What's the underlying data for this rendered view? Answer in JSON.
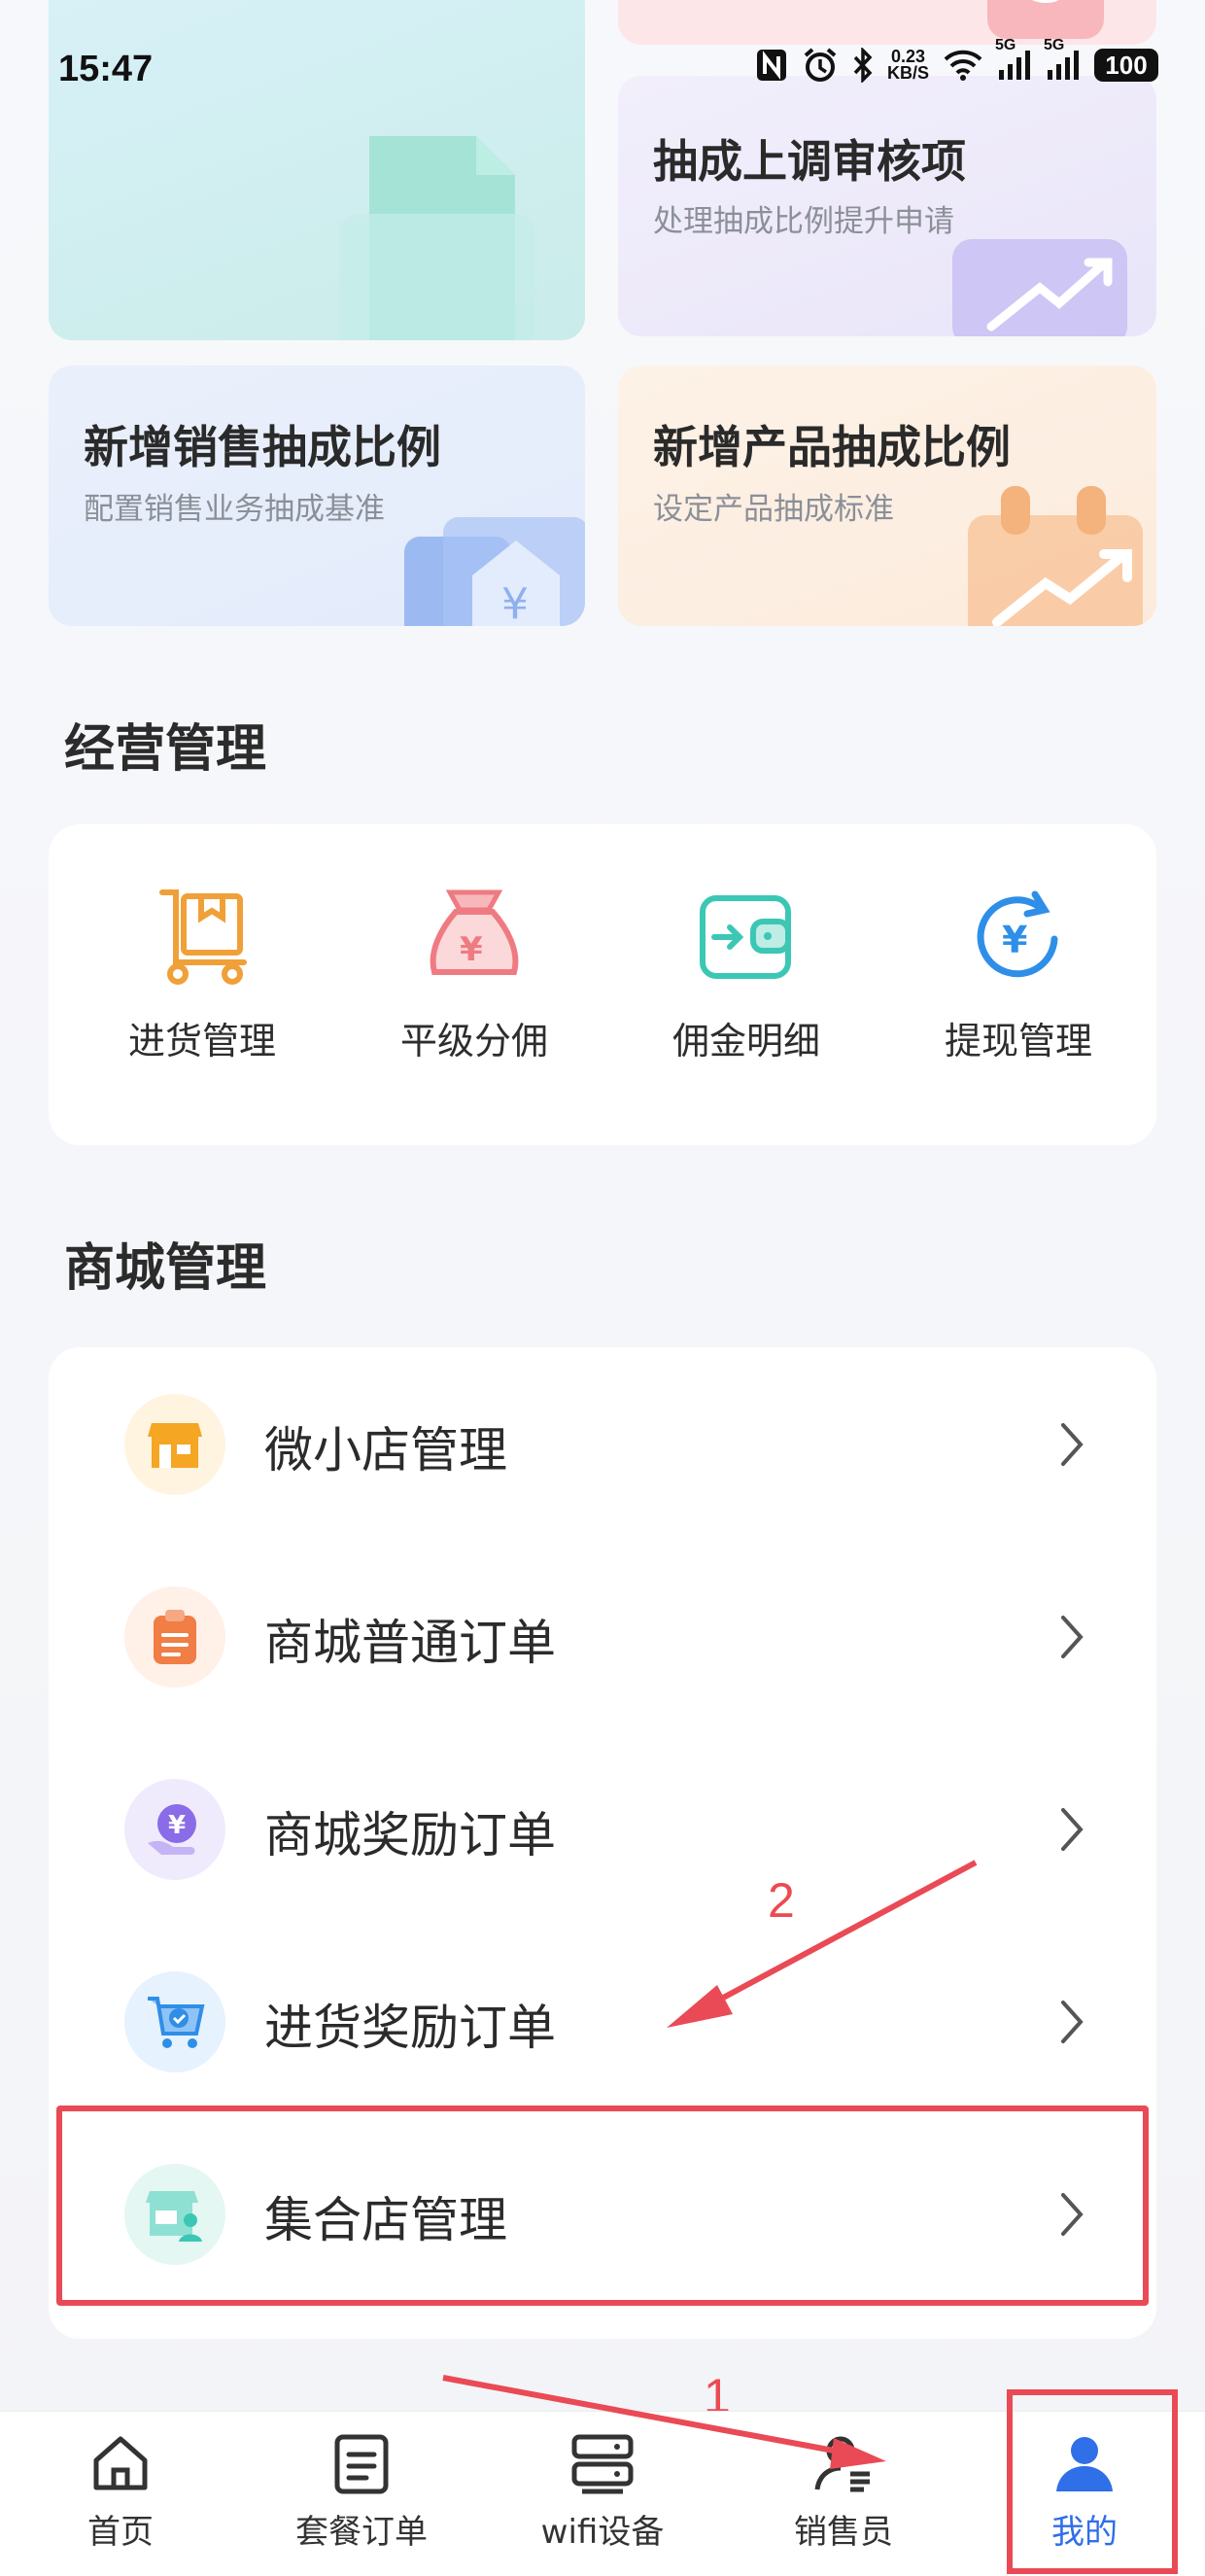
{
  "status_bar": {
    "time": "15:47",
    "speed_value": "0.23",
    "speed_unit": "KB/S",
    "network_1": "5G",
    "network_2": "5G",
    "battery": "100"
  },
  "cards": [
    {
      "title": "",
      "subtitle": ""
    },
    {
      "title": "抽成上调审核项",
      "subtitle": "处理抽成比例提升申请"
    },
    {
      "title": "新增销售抽成比例",
      "subtitle": "配置销售业务抽成基准"
    },
    {
      "title": "新增产品抽成比例",
      "subtitle": "设定产品抽成标准"
    }
  ],
  "business": {
    "title": "经营管理",
    "items": [
      {
        "label": "进货管理",
        "icon": "cart-icon",
        "color": "#f0a038"
      },
      {
        "label": "平级分佣",
        "icon": "money-bag-icon",
        "color": "#ef7b82"
      },
      {
        "label": "佣金明细",
        "icon": "wallet-icon",
        "color": "#3cc7b5"
      },
      {
        "label": "提现管理",
        "icon": "yuan-refresh-icon",
        "color": "#2f8fe8"
      }
    ]
  },
  "mall": {
    "title": "商城管理",
    "items": [
      {
        "label": "微小店管理",
        "icon": "shop-icon",
        "color": "#f5a623"
      },
      {
        "label": "商城普通订单",
        "icon": "clipboard-icon",
        "color": "#f07e45"
      },
      {
        "label": "商城奖励订单",
        "icon": "reward-hand-icon",
        "color": "#8a6be8"
      },
      {
        "label": "进货奖励订单",
        "icon": "shopping-cart-icon",
        "color": "#2f8fe8"
      },
      {
        "label": "集合店管理",
        "icon": "store-person-icon",
        "color": "#3cc7b5"
      }
    ]
  },
  "annotations": {
    "step1": "1",
    "step2": "2"
  },
  "tabbar": {
    "tabs": [
      {
        "label": "首页",
        "icon": "home-icon"
      },
      {
        "label": "套餐订单",
        "icon": "order-list-icon"
      },
      {
        "label": "wifi设备",
        "icon": "router-icon"
      },
      {
        "label": "销售员",
        "icon": "salesperson-icon"
      },
      {
        "label": "我的",
        "icon": "user-icon",
        "active": true
      }
    ],
    "active_color": "#2f6fe8"
  }
}
